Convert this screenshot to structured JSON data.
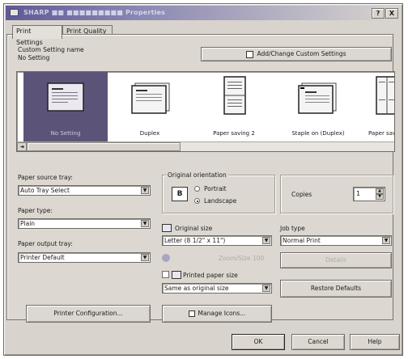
{
  "window": {
    "title": "SHARP ■■ ■■■■■■■■■ Properties",
    "help_btn": "?",
    "close_btn": "X"
  },
  "tabs": [
    {
      "label": "Print Settings"
    },
    {
      "label": "Print Quality"
    }
  ],
  "custom_setting": {
    "label": "Custom Setting name",
    "value": "No Setting",
    "add_change_button": "Add/Change Custom Settings"
  },
  "gallery": {
    "items": [
      {
        "label": "No Setting",
        "selected": true
      },
      {
        "label": "Duplex",
        "selected": false
      },
      {
        "label": "Paper saving 2",
        "selected": false
      },
      {
        "label": "Staple on (Duplex)",
        "selected": false
      },
      {
        "label": "Paper savi",
        "selected": false
      }
    ],
    "scroll_left": "◄"
  },
  "paper_source": {
    "label": "Paper source tray:",
    "value": "Auto Tray Select"
  },
  "paper_type": {
    "label": "Paper type:",
    "value": "Plain"
  },
  "paper_output": {
    "label": "Paper output tray:",
    "value": "Printer Default"
  },
  "orientation": {
    "label": "Original orientation",
    "icon_letter": "B",
    "portrait": "Portrait",
    "landscape": "Landscape",
    "selected": "landscape"
  },
  "copies": {
    "label": "Copies",
    "value": "1"
  },
  "original_size": {
    "label": "Original size",
    "value": "Letter (8 1/2\" x 11\")"
  },
  "zoom": {
    "label": "Zoom/Size 100"
  },
  "job_type": {
    "label": "Job type",
    "value": "Normal Print"
  },
  "details_button": "Details",
  "printed_paper_size": {
    "label": "Printed paper size",
    "value": "Same as original size"
  },
  "restore_defaults_button": "Restore Defaults",
  "printer_config_button": "Printer Configuration...",
  "manage_icons_button": "Manage Icons...",
  "footer": {
    "ok": "OK",
    "cancel": "Cancel",
    "help": "Help"
  },
  "colors": {
    "accent": "#5b5478",
    "title_gradient_start": "#5e5a94",
    "dialog_bg": "#d8d4cd"
  }
}
